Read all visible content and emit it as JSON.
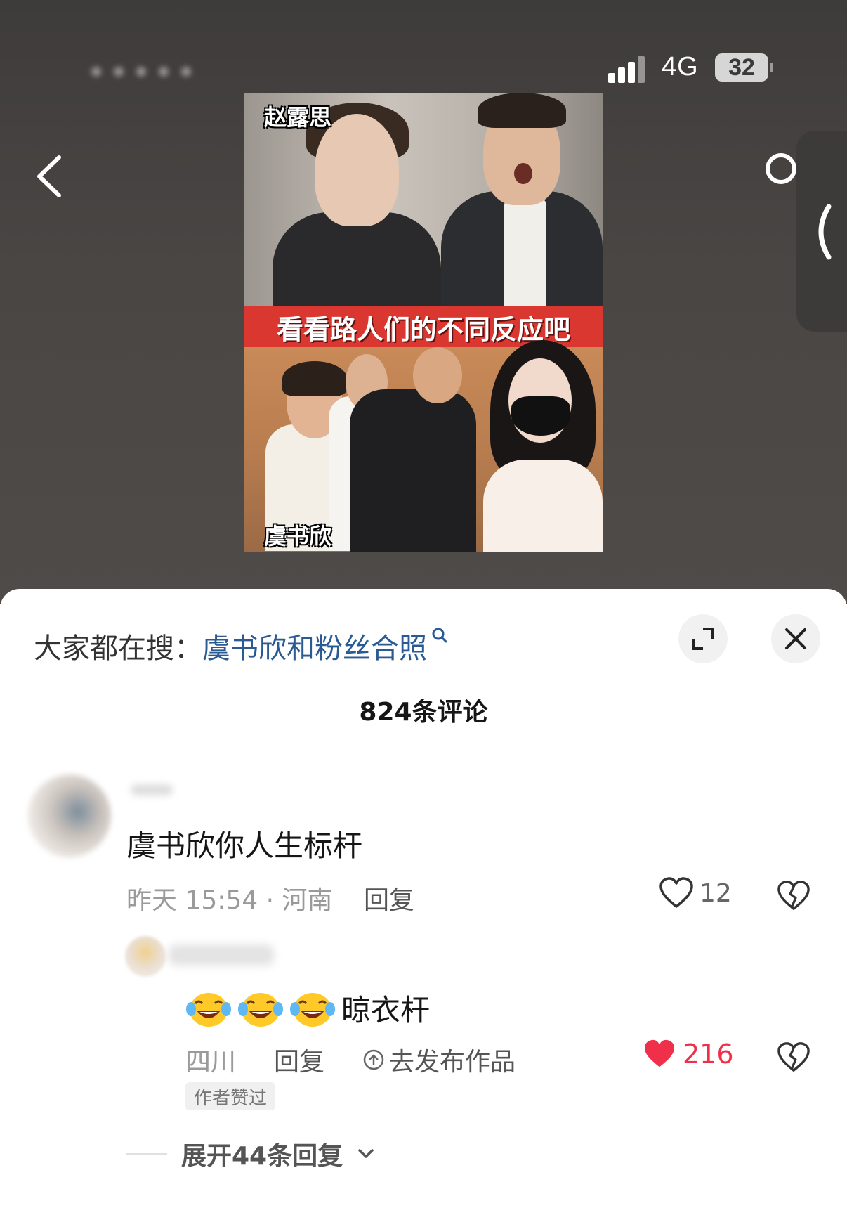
{
  "status_bar": {
    "network": "4G",
    "battery": "32",
    "signal_bars_filled": 3,
    "signal_bars_total": 4
  },
  "video": {
    "name_top": "赵露思",
    "caption": "看看路人们的不同反应吧",
    "name_bottom": "虞书欣"
  },
  "comments_sheet": {
    "hot_search_prefix": "大家都在搜：",
    "hot_search_query": "虞书欣和粉丝合照",
    "count_label": "824条评论",
    "comments": [
      {
        "text": "虞书欣你人生标杆",
        "meta": "昨天 15:54 · 河南",
        "reply_label": "回复",
        "likes": "12",
        "liked": false,
        "replies": [
          {
            "text": "晾衣杆",
            "emoji_count": 3,
            "meta": "四川",
            "reply_label": "回复",
            "publish_label": "去发布作品",
            "likes": "216",
            "liked": true,
            "author_badge": "作者赞过"
          }
        ],
        "expand_label": "展开44条回复"
      }
    ]
  },
  "colors": {
    "link_blue": "#2a5a94",
    "like_red": "#f0304a",
    "caption_red": "#d9372f"
  },
  "icons": [
    "back-arrow-icon",
    "search-icon",
    "side-panel-chevron-icon",
    "expand-icon",
    "close-icon",
    "heart-icon",
    "broken-heart-icon",
    "upload-icon",
    "chevron-down-icon",
    "laughing-crying-emoji"
  ]
}
